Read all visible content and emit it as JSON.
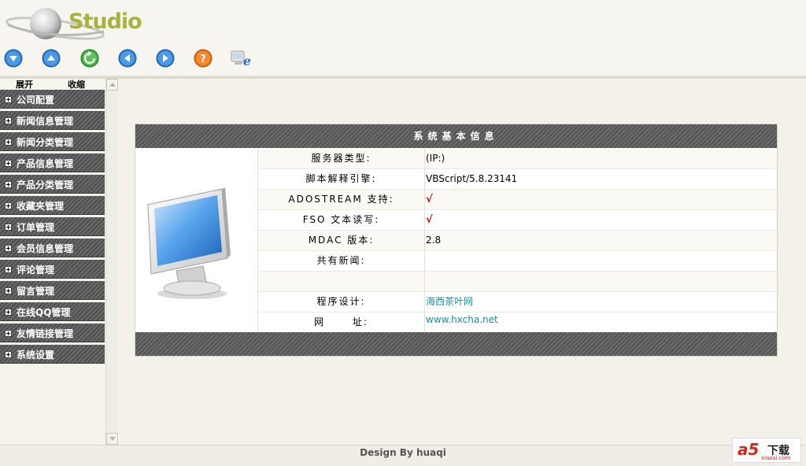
{
  "header": {
    "logo_text": "Studio",
    "toolbar": [
      {
        "name": "scroll-down-button",
        "icon": "arrow-down-icon"
      },
      {
        "name": "scroll-up-button",
        "icon": "arrow-up-icon"
      },
      {
        "name": "refresh-button",
        "icon": "refresh-icon"
      },
      {
        "name": "back-button",
        "icon": "arrow-left-icon"
      },
      {
        "name": "forward-button",
        "icon": "arrow-right-icon"
      },
      {
        "name": "help-button",
        "icon": "help-icon"
      },
      {
        "name": "browser-button",
        "icon": "ie-icon"
      }
    ]
  },
  "sidebar": {
    "expand_label": "展开",
    "collapse_label": "收缩",
    "items": [
      {
        "label": "公司配置"
      },
      {
        "label": "新闻信息管理"
      },
      {
        "label": "新闻分类管理"
      },
      {
        "label": "产品信息管理"
      },
      {
        "label": "产品分类管理"
      },
      {
        "label": "收藏夹管理"
      },
      {
        "label": "订单管理"
      },
      {
        "label": "会员信息管理"
      },
      {
        "label": "评论管理"
      },
      {
        "label": "留言管理"
      },
      {
        "label": "在线QQ管理"
      },
      {
        "label": "友情链接管理"
      },
      {
        "label": "系统设置"
      }
    ]
  },
  "panel": {
    "title": "系统基本信息",
    "rows": [
      {
        "key": "服务器类型:",
        "value": "(IP:)"
      },
      {
        "key": "脚本解释引擎:",
        "value": "VBScript/5.8.23141"
      },
      {
        "key": "ADOSTREAM 支持:",
        "value": "√"
      },
      {
        "key": "FSO 文本读写:",
        "value": "√"
      },
      {
        "key": "MDAC 版本:",
        "value": "2.8"
      },
      {
        "key": "共有新闻:",
        "value": ""
      },
      {
        "key": "",
        "value": ""
      },
      {
        "key": "程序设计:",
        "value": "海西茶叶网"
      },
      {
        "key": "网      址:",
        "value": "www.hxcha.net"
      }
    ]
  },
  "footer": {
    "text": "Design By huaqi"
  },
  "watermark": {
    "brand": "a5",
    "label": "下载",
    "url": "xiazai.com"
  },
  "colors": {
    "accent_logo": "#a8b23c",
    "menu_bg": "#5a5a5a",
    "check": "#cc0000",
    "link": "#1a8fa5"
  }
}
